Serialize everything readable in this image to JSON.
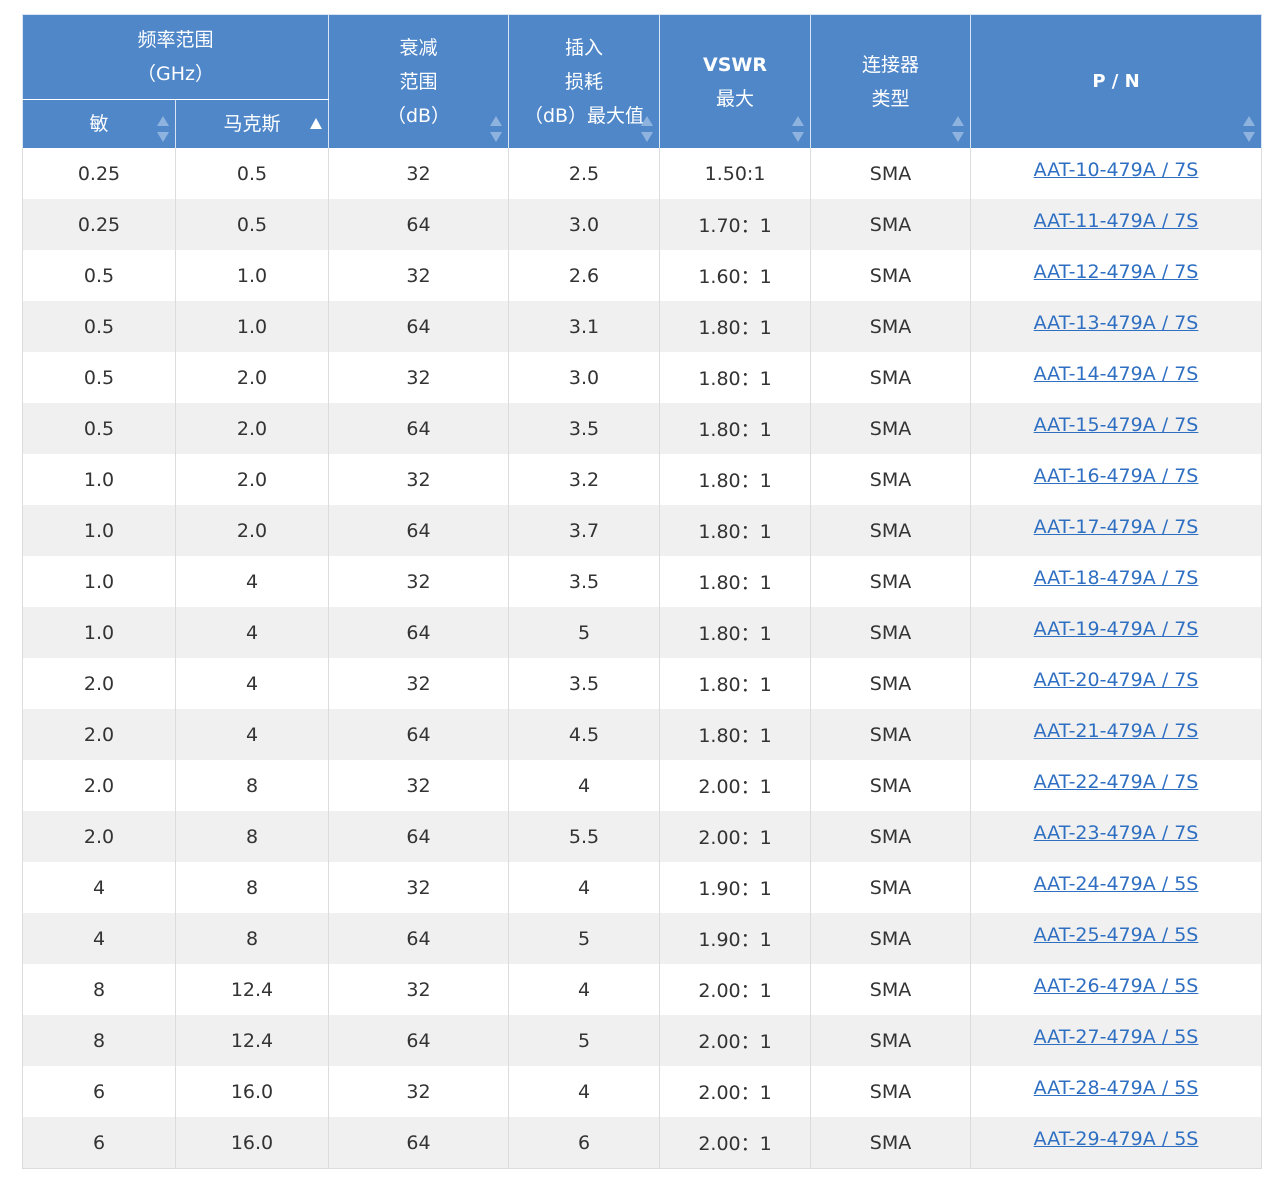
{
  "table": {
    "headers": {
      "freq_group": [
        "频率范围",
        "（GHz）"
      ],
      "min": "敏",
      "max": "马克斯",
      "attenuation": [
        "衰减",
        "范围",
        "（dB）"
      ],
      "insertion_loss": [
        "插入",
        "损耗",
        "（dB）最大值"
      ],
      "vswr": [
        "VSWR",
        "最大"
      ],
      "connector": [
        "连接器",
        "类型"
      ],
      "pn": "P / N"
    },
    "sorted_column": "max",
    "sort_direction": "ascending",
    "rows": [
      {
        "min": "0.25",
        "max": "0.5",
        "att": "32",
        "il": "2.5",
        "vswr": "1.50:1",
        "conn": "SMA",
        "pn": "AAT-10-479A / 7S"
      },
      {
        "min": "0.25",
        "max": "0.5",
        "att": "64",
        "il": "3.0",
        "vswr": "1.70：1",
        "conn": "SMA",
        "pn": "AAT-11-479A / 7S"
      },
      {
        "min": "0.5",
        "max": "1.0",
        "att": "32",
        "il": "2.6",
        "vswr": "1.60：1",
        "conn": "SMA",
        "pn": "AAT-12-479A / 7S"
      },
      {
        "min": "0.5",
        "max": "1.0",
        "att": "64",
        "il": "3.1",
        "vswr": "1.80：1",
        "conn": "SMA",
        "pn": "AAT-13-479A / 7S"
      },
      {
        "min": "0.5",
        "max": "2.0",
        "att": "32",
        "il": "3.0",
        "vswr": "1.80：1",
        "conn": "SMA",
        "pn": "AAT-14-479A / 7S"
      },
      {
        "min": "0.5",
        "max": "2.0",
        "att": "64",
        "il": "3.5",
        "vswr": "1.80：1",
        "conn": "SMA",
        "pn": "AAT-15-479A / 7S"
      },
      {
        "min": "1.0",
        "max": "2.0",
        "att": "32",
        "il": "3.2",
        "vswr": "1.80：1",
        "conn": "SMA",
        "pn": "AAT-16-479A / 7S"
      },
      {
        "min": "1.0",
        "max": "2.0",
        "att": "64",
        "il": "3.7",
        "vswr": "1.80：1",
        "conn": "SMA",
        "pn": "AAT-17-479A / 7S"
      },
      {
        "min": "1.0",
        "max": "4",
        "att": "32",
        "il": "3.5",
        "vswr": "1.80：1",
        "conn": "SMA",
        "pn": "AAT-18-479A / 7S"
      },
      {
        "min": "1.0",
        "max": "4",
        "att": "64",
        "il": "5",
        "vswr": "1.80：1",
        "conn": "SMA",
        "pn": "AAT-19-479A / 7S"
      },
      {
        "min": "2.0",
        "max": "4",
        "att": "32",
        "il": "3.5",
        "vswr": "1.80：1",
        "conn": "SMA",
        "pn": "AAT-20-479A / 7S"
      },
      {
        "min": "2.0",
        "max": "4",
        "att": "64",
        "il": "4.5",
        "vswr": "1.80：1",
        "conn": "SMA",
        "pn": "AAT-21-479A / 7S"
      },
      {
        "min": "2.0",
        "max": "8",
        "att": "32",
        "il": "4",
        "vswr": "2.00：1",
        "conn": "SMA",
        "pn": "AAT-22-479A / 7S"
      },
      {
        "min": "2.0",
        "max": "8",
        "att": "64",
        "il": "5.5",
        "vswr": "2.00：1",
        "conn": "SMA",
        "pn": "AAT-23-479A / 7S"
      },
      {
        "min": "4",
        "max": "8",
        "att": "32",
        "il": "4",
        "vswr": "1.90：1",
        "conn": "SMA",
        "pn": "AAT-24-479A / 5S"
      },
      {
        "min": "4",
        "max": "8",
        "att": "64",
        "il": "5",
        "vswr": "1.90：1",
        "conn": "SMA",
        "pn": "AAT-25-479A / 5S"
      },
      {
        "min": "8",
        "max": "12.4",
        "att": "32",
        "il": "4",
        "vswr": "2.00：1",
        "conn": "SMA",
        "pn": "AAT-26-479A / 5S"
      },
      {
        "min": "8",
        "max": "12.4",
        "att": "64",
        "il": "5",
        "vswr": "2.00：1",
        "conn": "SMA",
        "pn": "AAT-27-479A / 5S"
      },
      {
        "min": "6",
        "max": "16.0",
        "att": "32",
        "il": "4",
        "vswr": "2.00：1",
        "conn": "SMA",
        "pn": "AAT-28-479A / 5S"
      },
      {
        "min": "6",
        "max": "16.0",
        "att": "64",
        "il": "6",
        "vswr": "2.00：1",
        "conn": "SMA",
        "pn": "AAT-29-479A / 5S"
      }
    ]
  },
  "colors": {
    "header_bg": "#4f87c9",
    "link": "#2f6fc2",
    "stripe": "#f0f0f0"
  }
}
